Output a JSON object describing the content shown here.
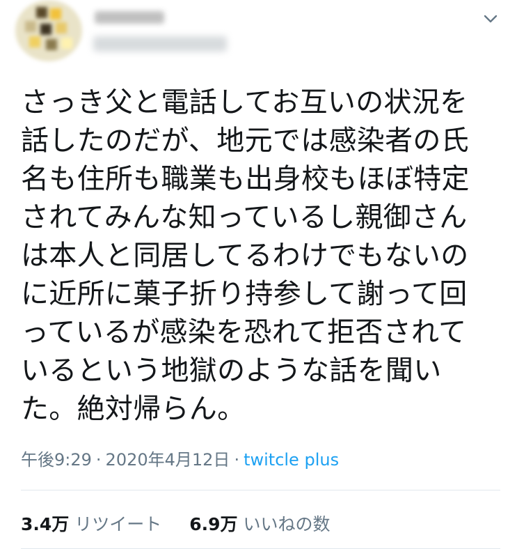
{
  "tweet": {
    "text": "さっき父と電話してお互いの状況を\n話したのだが、地元では感染者の氏\n名も住所も職業も出身校もほぼ特定\nされてみんな知っているし親御さん\nは本人と同居してるわけでもないの\nに近所に菓子折り持参して謝って回\nっているが感染を恐れて拒否されて\nいるという地獄のような話を聞い\nた。絶対帰らん。",
    "time": "午後9:29",
    "date": "2020年4月12日",
    "separator": "·",
    "source": "twitcle plus"
  },
  "stats": {
    "retweets_count": "3.4万",
    "retweets_label": "リツイート",
    "likes_count": "6.9万",
    "likes_label": "いいねの数"
  },
  "icons": {
    "menu": "chevron-down-icon"
  },
  "colors": {
    "text": "#14171a",
    "secondary": "#657786",
    "link": "#1da1f2",
    "divider": "#e1e8ed"
  }
}
